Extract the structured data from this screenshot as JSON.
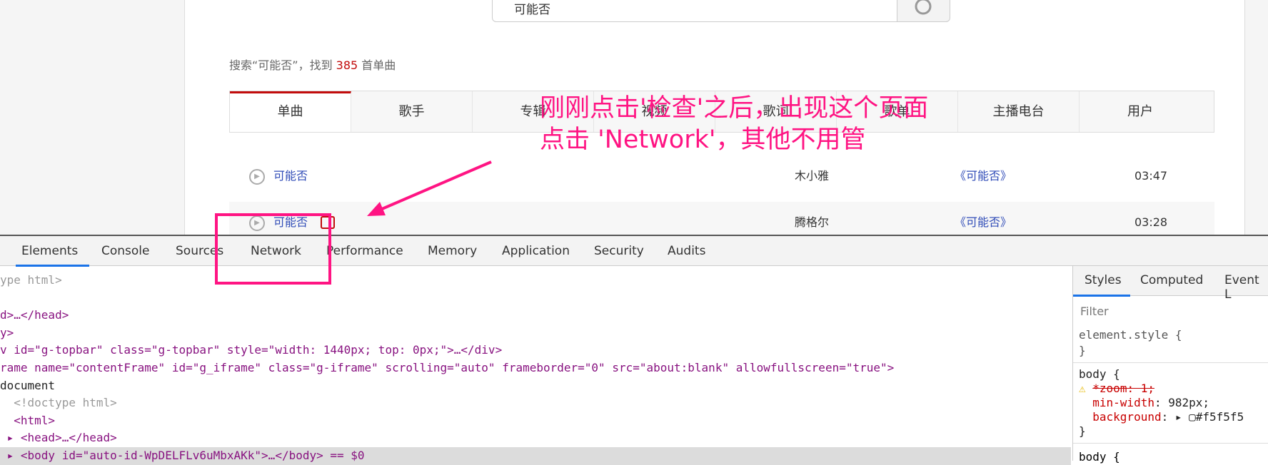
{
  "search": {
    "value": "可能否"
  },
  "summary": {
    "prefix": "搜索“可能否”，找到 ",
    "count": "385",
    "suffix": " 首单曲"
  },
  "tabs": [
    "单曲",
    "歌手",
    "专辑",
    "视频",
    "歌词",
    "歌单",
    "主播电台",
    "用户"
  ],
  "songs": [
    {
      "title": "可能否",
      "artist": "木小雅",
      "album": "《可能否》",
      "duration": "03:47"
    },
    {
      "title": "可能否",
      "artist": "腾格尔",
      "album": "《可能否》",
      "duration": "03:28",
      "mv": true
    }
  ],
  "devtools": {
    "tabs": [
      "Elements",
      "Console",
      "Sources",
      "Network",
      "Performance",
      "Memory",
      "Application",
      "Security",
      "Audits"
    ],
    "active_tab": "Elements",
    "code": [
      "ype html>",
      "",
      "d>…</head>",
      "y>",
      "v id=\"g-topbar\" class=\"g-topbar\" style=\"width: 1440px; top: 0px;\">…</div>",
      "rame name=\"contentFrame\" id=\"g_iframe\" class=\"g-iframe\" scrolling=\"auto\" frameborder=\"0\" src=\"about:blank\" allowfullscreen=\"true\">",
      "document",
      "  <!doctype html>",
      "  <html>",
      " ▸ <head>…</head>",
      " ▸ <body id=\"auto-id-WpDELFLv6uMbxAKk\">…</body> == $0"
    ],
    "styles": {
      "tabs": [
        "Styles",
        "Computed",
        "Event L"
      ],
      "filter_placeholder": "Filter",
      "rule1": "element.style {",
      "close": "}",
      "rule2": "body {",
      "prop_struck": "*zoom: 1;",
      "prop1_name": "min-width",
      "prop1_value": "982px;",
      "prop2_name": "background",
      "prop2_value": "#f5f5f5",
      "rule3": "body {"
    }
  },
  "annotation": {
    "line1": "刚刚点击'检查'之后，出现这个页面",
    "line2": "点击 'Network'，其他不用管",
    "color": "#ff1483"
  }
}
